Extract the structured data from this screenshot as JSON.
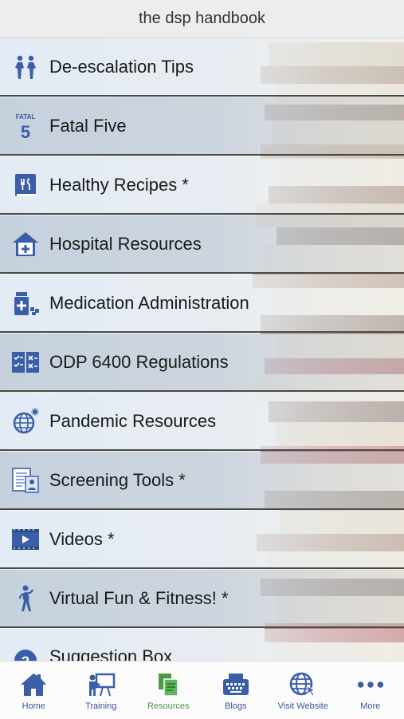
{
  "header": {
    "title": "the dsp handbook"
  },
  "menu": {
    "items": [
      {
        "label": "De-escalation Tips",
        "icon": "people-calm-icon"
      },
      {
        "label": "Fatal Five",
        "icon": "fatal-five-icon",
        "icon_text_top": "FATAL",
        "icon_text_num": "5"
      },
      {
        "label": "Healthy Recipes *",
        "icon": "recipe-book-icon"
      },
      {
        "label": "Hospital Resources",
        "icon": "hospital-icon"
      },
      {
        "label": "Medication Administration",
        "icon": "medication-icon"
      },
      {
        "label": "ODP 6400 Regulations",
        "icon": "checklist-icon"
      },
      {
        "label": "Pandemic Resources",
        "icon": "globe-virus-icon"
      },
      {
        "label": "Screening Tools *",
        "icon": "document-screening-icon"
      },
      {
        "label": "Videos *",
        "icon": "video-play-icon"
      },
      {
        "label": "Virtual Fun & Fitness! *",
        "icon": "fitness-person-icon"
      },
      {
        "label": "Suggestion Box",
        "icon": "help-icon"
      }
    ]
  },
  "tabbar": {
    "tabs": [
      {
        "label": "Home",
        "icon": "home-icon"
      },
      {
        "label": "Training",
        "icon": "training-board-icon"
      },
      {
        "label": "Resources",
        "icon": "resources-copy-icon",
        "active": true
      },
      {
        "label": "Blogs",
        "icon": "typewriter-icon"
      },
      {
        "label": "Visit Website",
        "icon": "globe-cursor-icon"
      },
      {
        "label": "More",
        "icon": "more-dots-icon"
      }
    ]
  },
  "colors": {
    "icon_blue": "#3b5ea8",
    "active_green": "#4b9a45",
    "header_bg": "#ededed"
  }
}
